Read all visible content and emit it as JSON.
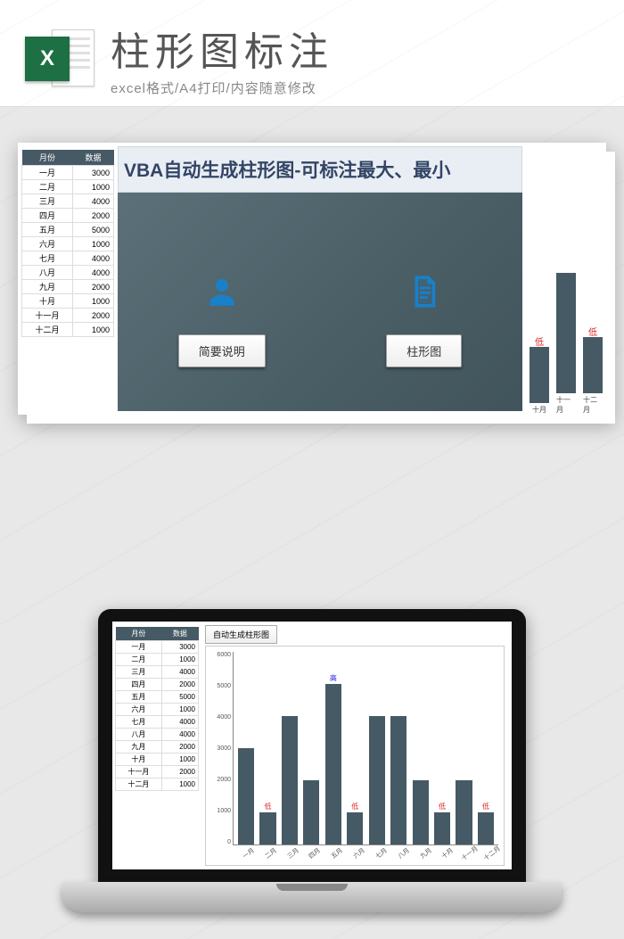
{
  "header": {
    "badge_letter": "X",
    "title": "柱形图标注",
    "subtitle": "excel格式/A4打印/内容随意修改"
  },
  "preview": {
    "panel_title": "VBA自动生成柱形图-可标注最大、最小",
    "btn_desc": "简要说明",
    "btn_chart": "柱形图"
  },
  "mini_chart": {
    "bars": [
      {
        "label": "低",
        "height": 0.35,
        "ax": "十月"
      },
      {
        "label": "",
        "height": 0.75,
        "ax": "十一月"
      },
      {
        "label": "低",
        "height": 0.35,
        "ax": "十二月"
      }
    ]
  },
  "laptop": {
    "chart_btn": "自动生成柱形图"
  },
  "table": {
    "headers": [
      "月份",
      "数据"
    ],
    "rows": [
      [
        "一月",
        "3000"
      ],
      [
        "二月",
        "1000"
      ],
      [
        "三月",
        "4000"
      ],
      [
        "四月",
        "2000"
      ],
      [
        "五月",
        "5000"
      ],
      [
        "六月",
        "1000"
      ],
      [
        "七月",
        "4000"
      ],
      [
        "八月",
        "4000"
      ],
      [
        "九月",
        "2000"
      ],
      [
        "十月",
        "1000"
      ],
      [
        "十一月",
        "2000"
      ],
      [
        "十二月",
        "1000"
      ]
    ]
  },
  "chart_data": {
    "type": "bar",
    "title": "",
    "xlabel": "",
    "ylabel": "",
    "ylim": [
      0,
      6000
    ],
    "y_ticks": [
      0,
      1000,
      2000,
      3000,
      4000,
      5000,
      6000
    ],
    "categories": [
      "一月",
      "二月",
      "三月",
      "四月",
      "五月",
      "六月",
      "七月",
      "八月",
      "九月",
      "十月",
      "十一月",
      "十二月"
    ],
    "values": [
      3000,
      1000,
      4000,
      2000,
      5000,
      1000,
      4000,
      4000,
      2000,
      1000,
      2000,
      1000
    ],
    "annotations": {
      "high_label": "高",
      "low_label": "低",
      "high_indices": [
        4
      ],
      "low_indices": [
        1,
        5,
        9,
        11
      ]
    }
  }
}
